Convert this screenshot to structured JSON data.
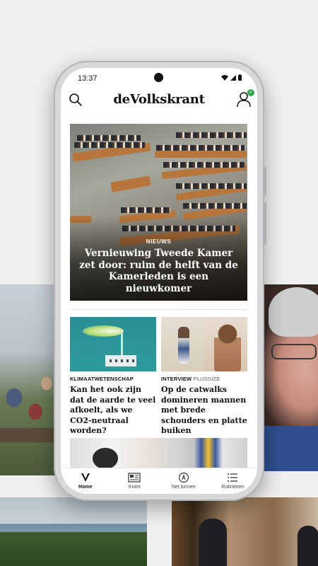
{
  "status_bar": {
    "time": "13:37"
  },
  "app": {
    "logo": "deVolkskrant"
  },
  "hero": {
    "label": "NIEUWS",
    "title": "Vernieuwing Tweede Kamer zet door: ruim de helft van de Kamerleden is een nieuwkomer"
  },
  "articles": [
    {
      "kicker": "KLIMAATWETENSCHAP",
      "sub": "",
      "title": "Kan het ook zijn dat de aarde te veel afkoelt, als we CO2-neutraal worden?"
    },
    {
      "kicker": "INTERVIEW",
      "sub": "PLUSSIZE",
      "title": "Op de catwalks domineren mannen met brede schouders en platte buiken"
    }
  ],
  "tabbar": {
    "items": [
      {
        "label": "Home",
        "icon": "v-logo-icon",
        "active": true
      },
      {
        "label": "Krant",
        "icon": "newspaper-icon",
        "active": false
      },
      {
        "label": "Net binnen",
        "icon": "clock-badge-icon",
        "active": false
      },
      {
        "label": "Rubrieken",
        "icon": "list-icon",
        "active": false
      }
    ]
  },
  "colors": {
    "accent_green": "#2fa84f",
    "text": "#111111"
  }
}
